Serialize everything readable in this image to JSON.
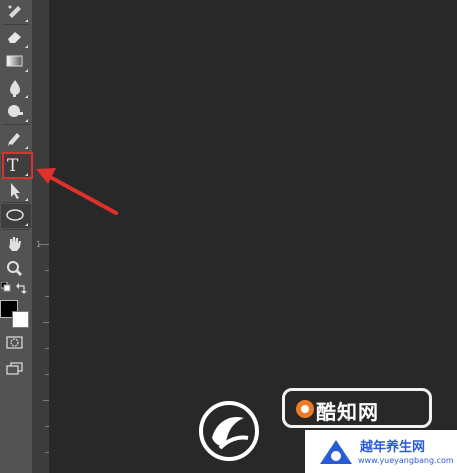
{
  "toolbar": {
    "tools": [
      {
        "id": "spot-healing",
        "icon": "spot-healing-brush-icon"
      },
      {
        "id": "eraser",
        "icon": "eraser-icon"
      },
      {
        "id": "gradient",
        "icon": "gradient-icon"
      },
      {
        "id": "blur",
        "icon": "blur-icon"
      },
      {
        "id": "dodge",
        "icon": "dodge-icon"
      },
      {
        "id": "pen",
        "icon": "pen-icon"
      },
      {
        "id": "type",
        "icon": "type-icon",
        "label": "T",
        "highlighted": true
      },
      {
        "id": "path-selection",
        "icon": "path-selection-icon"
      },
      {
        "id": "ellipse",
        "icon": "ellipse-icon"
      },
      {
        "id": "hand",
        "icon": "hand-icon"
      },
      {
        "id": "zoom",
        "icon": "zoom-icon"
      }
    ],
    "foreground_color": "#000000",
    "background_color": "#ffffff"
  },
  "ruler": {
    "label": "1"
  },
  "annotation": {
    "color": "#e0302a"
  },
  "watermark": {
    "brand": "酷知网",
    "sub_title": "越年养生网",
    "sub_url": "www.yueyangbang.com"
  }
}
